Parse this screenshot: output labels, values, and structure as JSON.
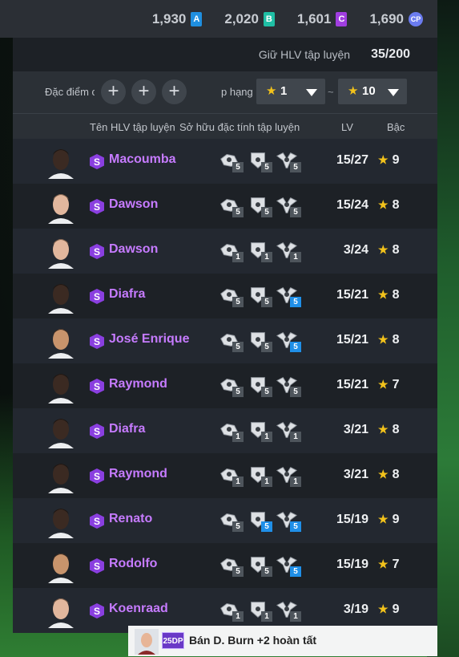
{
  "currencies": [
    {
      "value": "1,930",
      "icon": "A"
    },
    {
      "value": "2,020",
      "icon": "B"
    },
    {
      "value": "1,601",
      "icon": "C"
    },
    {
      "value": "1,690",
      "icon": "CP"
    }
  ],
  "count": {
    "label": "Giữ HLV tập luyện",
    "value": "35/200"
  },
  "filter": {
    "traits_label": "Đặc điểm c",
    "plus": "+",
    "rank_label": "p hạng",
    "min_value": "1",
    "tilde": "~",
    "max_value": "10"
  },
  "columns": {
    "name": "Tên HLV tập luyện",
    "traits": "Sở hữu đặc tính tập luyện",
    "lv": "LV",
    "grade": "Bậc"
  },
  "colors": {
    "name": "#c67bff",
    "star": "#f2c21b",
    "skill_level_blue": "#1f8fe8"
  },
  "rows": [
    {
      "name": "Macoumba",
      "skin": "dark",
      "skills": [
        {
          "lv": "5",
          "blue": false
        },
        {
          "lv": "5",
          "blue": false
        },
        {
          "lv": "5",
          "blue": false
        }
      ],
      "level": "15/27",
      "grade": "9"
    },
    {
      "name": "Dawson",
      "skin": "light",
      "skills": [
        {
          "lv": "5",
          "blue": false
        },
        {
          "lv": "5",
          "blue": false
        },
        {
          "lv": "5",
          "blue": false
        }
      ],
      "level": "15/24",
      "grade": "8"
    },
    {
      "name": "Dawson",
      "skin": "light",
      "skills": [
        {
          "lv": "1",
          "blue": false
        },
        {
          "lv": "1",
          "blue": false
        },
        {
          "lv": "1",
          "blue": false
        }
      ],
      "level": "3/24",
      "grade": "8"
    },
    {
      "name": "Diafra",
      "skin": "dark",
      "skills": [
        {
          "lv": "5",
          "blue": false
        },
        {
          "lv": "5",
          "blue": false
        },
        {
          "lv": "5",
          "blue": true
        }
      ],
      "level": "15/21",
      "grade": "8"
    },
    {
      "name": "José Enrique",
      "skin": "tan",
      "skills": [
        {
          "lv": "5",
          "blue": false
        },
        {
          "lv": "5",
          "blue": false
        },
        {
          "lv": "5",
          "blue": true
        }
      ],
      "level": "15/21",
      "grade": "8"
    },
    {
      "name": "Raymond",
      "skin": "dark",
      "skills": [
        {
          "lv": "5",
          "blue": false
        },
        {
          "lv": "5",
          "blue": false
        },
        {
          "lv": "5",
          "blue": false
        }
      ],
      "level": "15/21",
      "grade": "7"
    },
    {
      "name": "Diafra",
      "skin": "dark",
      "skills": [
        {
          "lv": "1",
          "blue": false
        },
        {
          "lv": "1",
          "blue": false
        },
        {
          "lv": "1",
          "blue": false
        }
      ],
      "level": "3/21",
      "grade": "8"
    },
    {
      "name": "Raymond",
      "skin": "dark",
      "skills": [
        {
          "lv": "1",
          "blue": false
        },
        {
          "lv": "1",
          "blue": false
        },
        {
          "lv": "1",
          "blue": false
        }
      ],
      "level": "3/21",
      "grade": "8"
    },
    {
      "name": "Renato",
      "skin": "dark",
      "skills": [
        {
          "lv": "5",
          "blue": false
        },
        {
          "lv": "5",
          "blue": true
        },
        {
          "lv": "5",
          "blue": true
        }
      ],
      "level": "15/19",
      "grade": "9"
    },
    {
      "name": "Rodolfo",
      "skin": "tan",
      "skills": [
        {
          "lv": "5",
          "blue": false
        },
        {
          "lv": "5",
          "blue": false
        },
        {
          "lv": "5",
          "blue": true
        }
      ],
      "level": "15/19",
      "grade": "7"
    },
    {
      "name": "Koenraad",
      "skin": "light",
      "skills": [
        {
          "lv": "1",
          "blue": false
        },
        {
          "lv": "1",
          "blue": false
        },
        {
          "lv": "1",
          "blue": false
        }
      ],
      "level": "3/19",
      "grade": "9"
    }
  ],
  "toast": {
    "tag": "25DP",
    "text": "Bán D. Burn +2 hoàn tất"
  }
}
